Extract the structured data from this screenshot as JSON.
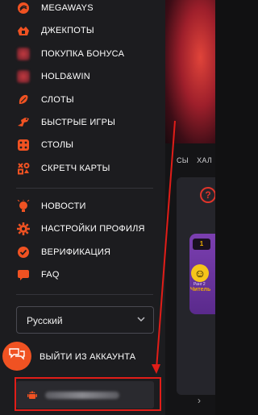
{
  "menu": {
    "items": [
      {
        "label": "MEGAWAYS",
        "icon": "megaways-icon"
      },
      {
        "label": "ДЖЕКПОТЫ",
        "icon": "jackpot-icon"
      },
      {
        "label": "ПОКУПКА БОНУСА",
        "icon": "bonus-buy-icon"
      },
      {
        "label": "HOLD&WIN",
        "icon": "hold-win-icon"
      },
      {
        "label": "СЛОТЫ",
        "icon": "slots-icon"
      },
      {
        "label": "БЫСТРЫЕ ИГРЫ",
        "icon": "fast-games-icon"
      },
      {
        "label": "СТОЛЫ",
        "icon": "tables-icon"
      },
      {
        "label": "СКРЕТЧ КАРТЫ",
        "icon": "scratch-cards-icon"
      }
    ],
    "secondary": [
      {
        "label": "НОВОСТИ",
        "icon": "news-icon"
      },
      {
        "label": "НАСТРОЙКИ ПРОФИЛЯ",
        "icon": "profile-settings-icon"
      },
      {
        "label": "ВЕРИФИКАЦИЯ",
        "icon": "verification-icon"
      },
      {
        "label": "FAQ",
        "icon": "faq-icon"
      }
    ]
  },
  "language": {
    "selected": "Русский"
  },
  "logout": {
    "label": "ВЫЙТИ ИЗ АККАУНТА"
  },
  "app_download": {
    "icon": "android-icon"
  },
  "background": {
    "tabs": [
      "СЫ",
      "ХАЛ"
    ],
    "card": {
      "badge": "1",
      "sub": "Ранг 2",
      "title": "Читель"
    }
  },
  "colors": {
    "accent": "#f05222",
    "highlight": "#e11d18",
    "drawer_bg": "#1c1c1f"
  }
}
